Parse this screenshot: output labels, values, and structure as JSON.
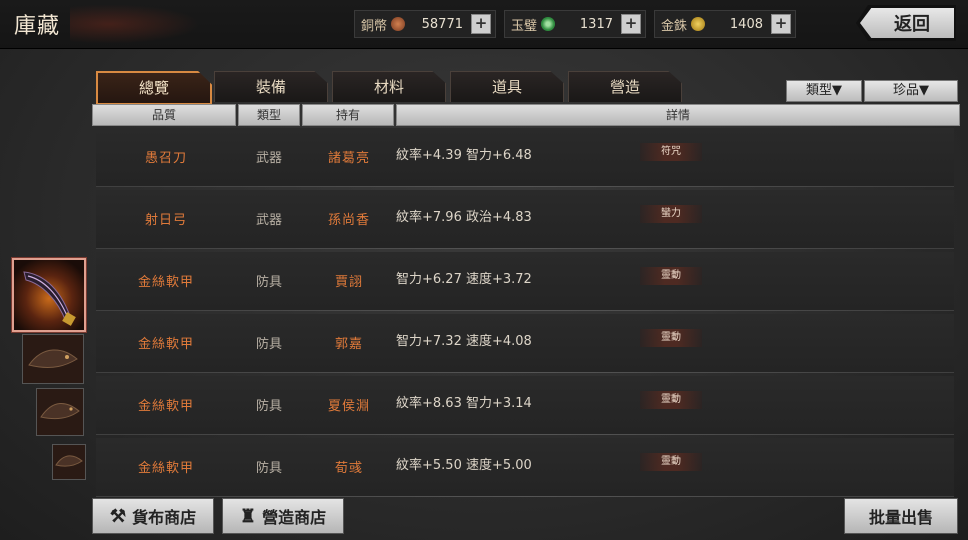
{
  "header": {
    "title": "庫藏",
    "back_label": "返回"
  },
  "currencies": [
    {
      "label": "銅幣",
      "amount": "58771",
      "coin_color": "#b0603a"
    },
    {
      "label": "玉璧",
      "amount": "1317",
      "coin_color": "#4caf50"
    },
    {
      "label": "金銖",
      "amount": "1408",
      "coin_color": "#d4b030"
    }
  ],
  "tabs": [
    {
      "label": "總覽",
      "active": true
    },
    {
      "label": "裝備",
      "active": false
    },
    {
      "label": "材料",
      "active": false
    },
    {
      "label": "道具",
      "active": false
    },
    {
      "label": "營造",
      "active": false
    }
  ],
  "filters": {
    "type_label": "類型▼",
    "rarity_label": "珍品▼"
  },
  "table": {
    "columns": [
      "品質",
      "類型",
      "持有",
      "詳情"
    ],
    "rows": [
      {
        "name": "愚召刀",
        "type": "武器",
        "owner": "諸葛亮",
        "detail": "紋率+4.39  智力+6.48",
        "tag": "符咒"
      },
      {
        "name": "射日弓",
        "type": "武器",
        "owner": "孫尚香",
        "detail": "紋率+7.96  政治+4.83",
        "tag": "蠻力"
      },
      {
        "name": "金絲軟甲",
        "type": "防具",
        "owner": "賈詡",
        "detail": "智力+6.27  速度+3.72",
        "tag": "靈動"
      },
      {
        "name": "金絲軟甲",
        "type": "防具",
        "owner": "郭嘉",
        "detail": "智力+7.32  速度+4.08",
        "tag": "靈動"
      },
      {
        "name": "金絲軟甲",
        "type": "防具",
        "owner": "夏侯淵",
        "detail": "紋率+8.63  智力+3.14",
        "tag": "靈動"
      },
      {
        "name": "金絲軟甲",
        "type": "防具",
        "owner": "荀彧",
        "detail": "紋率+5.50  速度+5.00",
        "tag": "靈動"
      }
    ]
  },
  "bottom": {
    "shop1_label": "貨布商店",
    "shop2_label": "營造商店",
    "sell_label": "批量出售"
  }
}
